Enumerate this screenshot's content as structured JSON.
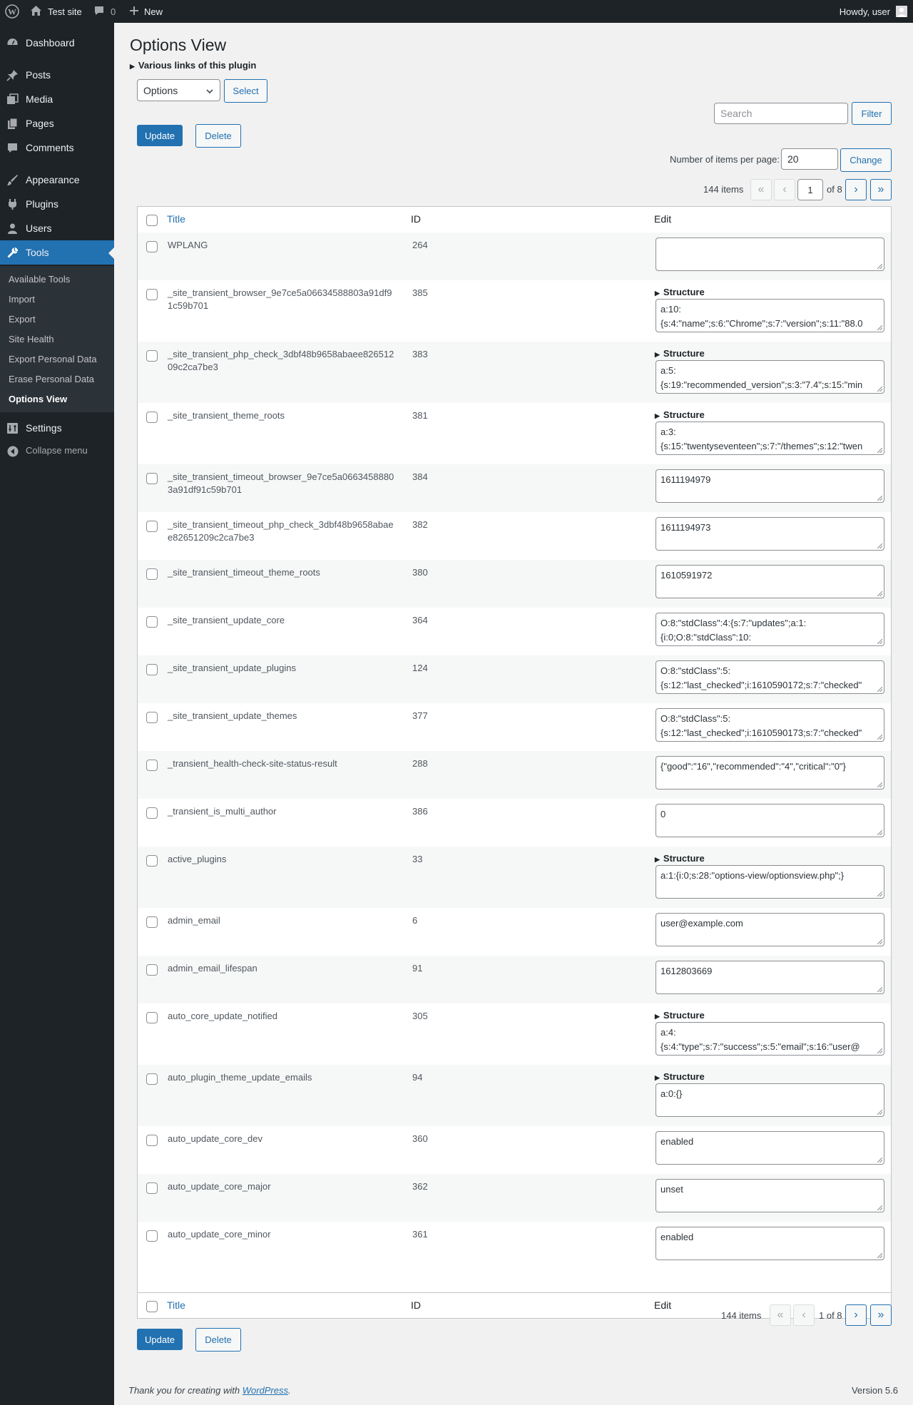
{
  "adminbar": {
    "site_name": "Test site",
    "comments_count": "0",
    "new_label": "New",
    "howdy": "Howdy, user"
  },
  "sidebar": {
    "items": [
      {
        "label": "Dashboard",
        "icon": "dashboard-icon"
      },
      {
        "label": "Posts",
        "icon": "pin-icon"
      },
      {
        "label": "Media",
        "icon": "media-icon"
      },
      {
        "label": "Pages",
        "icon": "pages-icon"
      },
      {
        "label": "Comments",
        "icon": "comment-icon"
      },
      {
        "label": "Appearance",
        "icon": "brush-icon"
      },
      {
        "label": "Plugins",
        "icon": "plug-icon"
      },
      {
        "label": "Users",
        "icon": "user-icon"
      },
      {
        "label": "Tools",
        "icon": "wrench-icon"
      },
      {
        "label": "Settings",
        "icon": "settings-icon"
      }
    ],
    "submenu": [
      "Available Tools",
      "Import",
      "Export",
      "Site Health",
      "Export Personal Data",
      "Erase Personal Data",
      "Options View"
    ],
    "collapse_label": "Collapse menu"
  },
  "page": {
    "title": "Options View",
    "links_label": "Various links of this plugin",
    "select_value": "Options",
    "select_button": "Select",
    "search_placeholder": "Search",
    "filter_button": "Filter",
    "update_button": "Update",
    "delete_button": "Delete",
    "per_page_label": "Number of items per page:",
    "per_page_value": "20",
    "change_button": "Change",
    "items_count": "144 items",
    "current_page": "1",
    "total_pages": "of 8",
    "bottom_page_text": "1 of 8",
    "first_glyph": "«",
    "prev_glyph": "‹",
    "next_glyph": "›",
    "last_glyph": "»"
  },
  "table": {
    "col_title": "Title",
    "col_id": "ID",
    "col_edit": "Edit",
    "structure_label": "Structure",
    "rows": [
      {
        "title": "WPLANG",
        "id": "264",
        "value": "",
        "structure": false
      },
      {
        "title": "_site_transient_browser_9e7ce5a06634588803a91df91c59b701",
        "id": "385",
        "value": "a:10:\n{s:4:\"name\";s:6:\"Chrome\";s:7:\"version\";s:11:\"88.0",
        "structure": true
      },
      {
        "title": "_site_transient_php_check_3dbf48b9658abaee82651209c2ca7be3",
        "id": "383",
        "value": "a:5:\n{s:19:\"recommended_version\";s:3:\"7.4\";s:15:\"min",
        "structure": true
      },
      {
        "title": "_site_transient_theme_roots",
        "id": "381",
        "value": "a:3:\n{s:15:\"twentyseventeen\";s:7:\"/themes\";s:12:\"twen",
        "structure": true
      },
      {
        "title": "_site_transient_timeout_browser_9e7ce5a06634588803a91df91c59b701",
        "id": "384",
        "value": "1611194979",
        "structure": false
      },
      {
        "title": "_site_transient_timeout_php_check_3dbf48b9658abaee82651209c2ca7be3",
        "id": "382",
        "value": "1611194973",
        "structure": false
      },
      {
        "title": "_site_transient_timeout_theme_roots",
        "id": "380",
        "value": "1610591972",
        "structure": false
      },
      {
        "title": "_site_transient_update_core",
        "id": "364",
        "value": "O:8:\"stdClass\":4:{s:7:\"updates\";a:1:\n{i:0;O:8:\"stdClass\":10:",
        "structure": false
      },
      {
        "title": "_site_transient_update_plugins",
        "id": "124",
        "value": "O:8:\"stdClass\":5:\n{s:12:\"last_checked\";i:1610590172;s:7:\"checked\"",
        "structure": false
      },
      {
        "title": "_site_transient_update_themes",
        "id": "377",
        "value": "O:8:\"stdClass\":5:\n{s:12:\"last_checked\";i:1610590173;s:7:\"checked\"",
        "structure": false
      },
      {
        "title": "_transient_health-check-site-status-result",
        "id": "288",
        "value": "{\"good\":\"16\",\"recommended\":\"4\",\"critical\":\"0\"}",
        "structure": false
      },
      {
        "title": "_transient_is_multi_author",
        "id": "386",
        "value": "0",
        "structure": false
      },
      {
        "title": "active_plugins",
        "id": "33",
        "value": "a:1:{i:0;s:28:\"options-view/optionsview.php\";}",
        "structure": true
      },
      {
        "title": "admin_email",
        "id": "6",
        "value": "user@example.com",
        "structure": false
      },
      {
        "title": "admin_email_lifespan",
        "id": "91",
        "value": "1612803669",
        "structure": false
      },
      {
        "title": "auto_core_update_notified",
        "id": "305",
        "value": "a:4:\n{s:4:\"type\";s:7:\"success\";s:5:\"email\";s:16:\"user@",
        "structure": true
      },
      {
        "title": "auto_plugin_theme_update_emails",
        "id": "94",
        "value": "a:0:{}",
        "structure": true
      },
      {
        "title": "auto_update_core_dev",
        "id": "360",
        "value": "enabled",
        "structure": false
      },
      {
        "title": "auto_update_core_major",
        "id": "362",
        "value": "unset",
        "structure": false
      },
      {
        "title": "auto_update_core_minor",
        "id": "361",
        "value": "enabled",
        "structure": false
      }
    ]
  },
  "footer": {
    "thanks_prefix": "Thank you for creating with ",
    "wordpress_link": "WordPress",
    "thanks_suffix": ".",
    "version": "Version 5.6"
  }
}
